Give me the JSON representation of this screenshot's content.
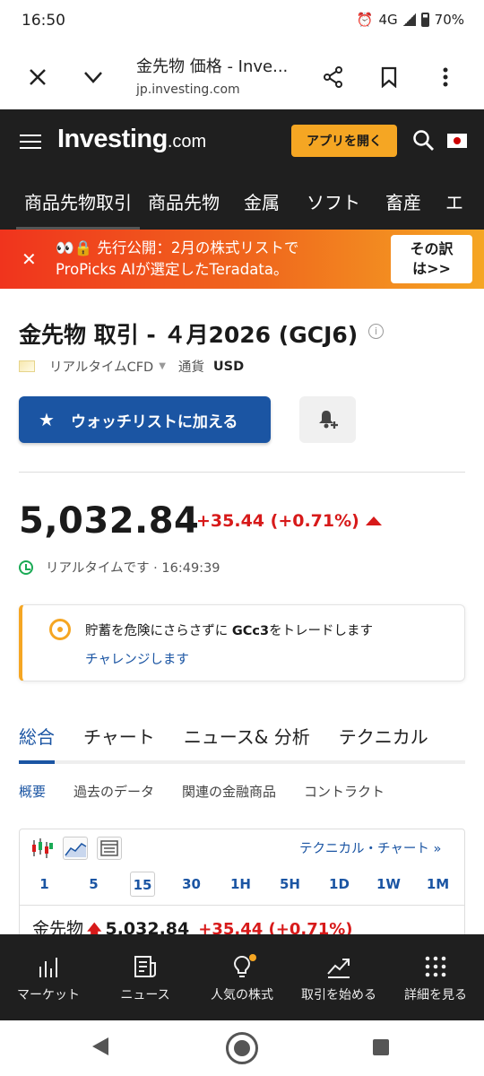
{
  "status": {
    "time": "16:50",
    "network": "4G",
    "battery": "70%"
  },
  "browser": {
    "title": "金先物 価格 - Inve...",
    "url": "jp.investing.com"
  },
  "header": {
    "logo_main": "Investing",
    "logo_suffix": ".com",
    "open_app": "アプリを開く"
  },
  "category_nav": [
    "商品先物取引",
    "商品先物",
    "金属",
    "ソフト",
    "畜産",
    "エ"
  ],
  "promo": {
    "line1": "👀🔒 先行公開：2月の株式リストで",
    "line2": "ProPicks AIが選定したTeradata。",
    "button_line1": "その訳",
    "button_line2": "は>>"
  },
  "instrument": {
    "title": "金先物 取引 - ４月2026 (GCJ6)",
    "source": "リアルタイムCFD",
    "currency_label": "通貨",
    "currency": "USD",
    "watchlist_button": "ウォッチリストに加える",
    "price": "5,032.84",
    "change": "+35.44 (+0.71%)",
    "realtime_label": "リアルタイムです · 16:49:39"
  },
  "challenge": {
    "text_pre": "貯蓄を危険にさらさずに ",
    "symbol": "GCc3",
    "text_post": "をトレードします",
    "link": "チャレンジします"
  },
  "main_tabs": [
    "総合",
    "チャート",
    "ニュース& 分析",
    "テクニカル"
  ],
  "sub_tabs": [
    "概要",
    "過去のデータ",
    "関連の金融商品",
    "コントラクト"
  ],
  "chart_widget": {
    "tech_link": "テクニカル・チャート »",
    "periods": [
      "1",
      "5",
      "15",
      "30",
      "1H",
      "5H",
      "1D",
      "1W",
      "1M"
    ],
    "active_period": "15",
    "name": "金先物",
    "price": "5,032.84",
    "change": "+35.44 (+0.71%)"
  },
  "bottom_nav": [
    "マーケット",
    "ニュース",
    "人気の株式",
    "取引を始める",
    "詳細を見る"
  ],
  "colors": {
    "accent": "#1b55a3",
    "negative": "#d71a1a",
    "brand": "#f5a623",
    "header_bg": "#1f1f1f"
  }
}
